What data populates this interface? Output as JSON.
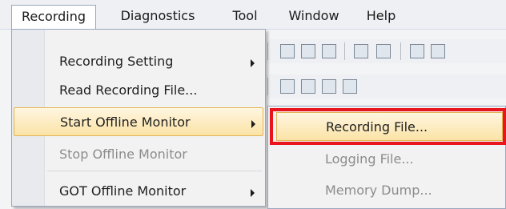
{
  "menubar": {
    "items": [
      {
        "label": "Recording",
        "open": true
      },
      {
        "label": "Diagnostics"
      },
      {
        "label": "Tool"
      },
      {
        "label": "Window"
      },
      {
        "label": "Help"
      }
    ]
  },
  "dropdown": {
    "items": [
      {
        "label": "Recording Setting",
        "submenu": true,
        "enabled": true
      },
      {
        "label": "Read Recording File...",
        "submenu": false,
        "enabled": true
      },
      {
        "label": "Start Offline Monitor",
        "submenu": true,
        "enabled": true,
        "highlighted": true
      },
      {
        "label": "Stop Offline Monitor",
        "submenu": false,
        "enabled": false
      },
      {
        "label": "GOT Offline Monitor",
        "submenu": true,
        "enabled": true
      }
    ]
  },
  "submenu": {
    "items": [
      {
        "label": "Recording File...",
        "enabled": true,
        "highlighted": true
      },
      {
        "label": "Logging File...",
        "enabled": false
      },
      {
        "label": "Memory Dump...",
        "enabled": false
      }
    ]
  },
  "annotation": {
    "color": "#e8151c",
    "target": "Recording File..."
  },
  "colors": {
    "highlight": "#fbe3a6",
    "highlight_border": "#e3b556",
    "disabled_text": "#8c8c8c"
  },
  "toolbar": {
    "icons": [
      "toolbar-icon",
      "toolbar-icon",
      "toolbar-icon",
      "toolbar-icon",
      "toolbar-icon",
      "toolbar-icon",
      "toolbar-icon"
    ]
  }
}
